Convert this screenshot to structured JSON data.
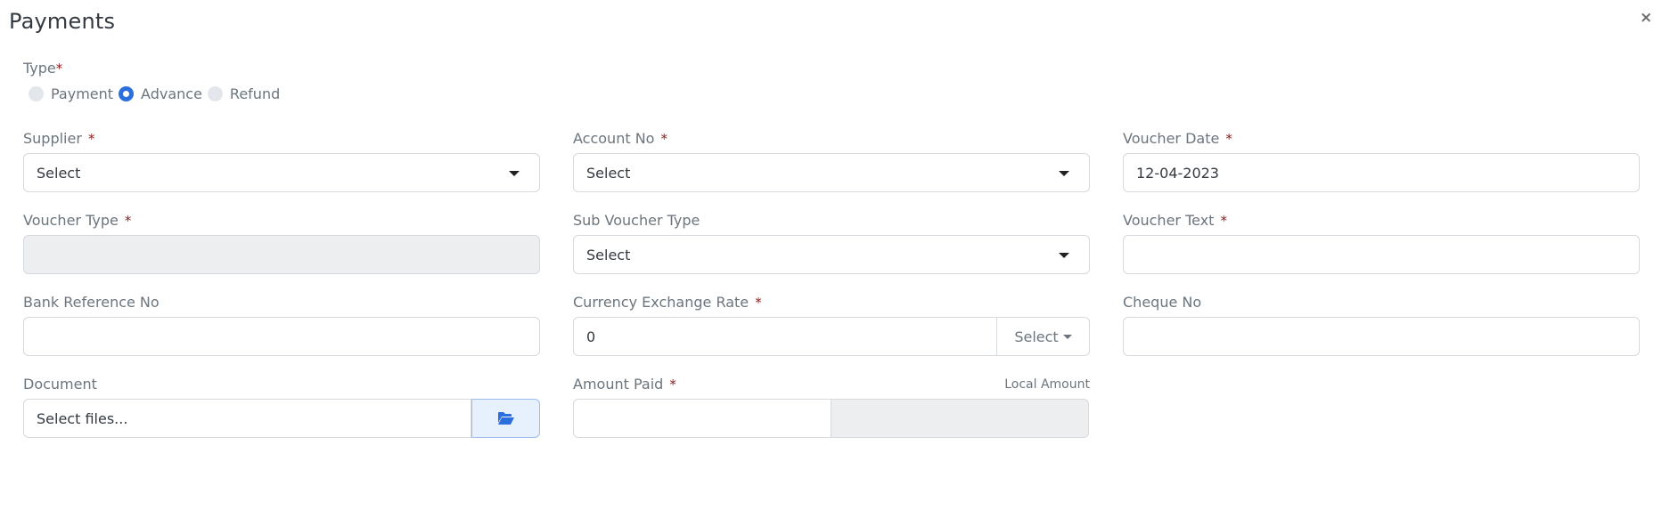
{
  "dialog": {
    "title": "Payments",
    "close_label": "×"
  },
  "type": {
    "label": "Type",
    "required_mark": "*",
    "options": [
      {
        "label": "Payment",
        "checked": false
      },
      {
        "label": "Advance",
        "checked": true
      },
      {
        "label": "Refund",
        "checked": false
      }
    ],
    "selected": "Advance"
  },
  "fields": {
    "supplier": {
      "label": "Supplier",
      "required": "*",
      "value": "Select"
    },
    "account_no": {
      "label": "Account No",
      "required": "*",
      "value": "Select"
    },
    "voucher_date": {
      "label": "Voucher Date",
      "required": "*",
      "value": "12-04-2023"
    },
    "voucher_type": {
      "label": "Voucher Type",
      "required": "*",
      "value": ""
    },
    "sub_voucher_type": {
      "label": "Sub Voucher Type",
      "value": "Select"
    },
    "voucher_text": {
      "label": "Voucher Text",
      "required": "*",
      "value": ""
    },
    "bank_reference_no": {
      "label": "Bank Reference No",
      "value": ""
    },
    "currency_exchange_rate": {
      "label": "Currency Exchange Rate",
      "required": "*",
      "value": "0",
      "currency_select": "Select"
    },
    "cheque_no": {
      "label": "Cheque No",
      "value": ""
    },
    "document": {
      "label": "Document",
      "placeholder": "Select files..."
    },
    "amount_paid": {
      "label": "Amount Paid",
      "required": "*",
      "value": "",
      "local_amount_label": "Local Amount",
      "local_amount_value": ""
    }
  },
  "icons": {
    "close": "close-icon",
    "caret": "caret-down-icon",
    "folder": "folder-open-icon"
  },
  "colors": {
    "accent": "#2b6fde",
    "required": "#8b1a1a",
    "disabled_bg": "#eceef0"
  }
}
